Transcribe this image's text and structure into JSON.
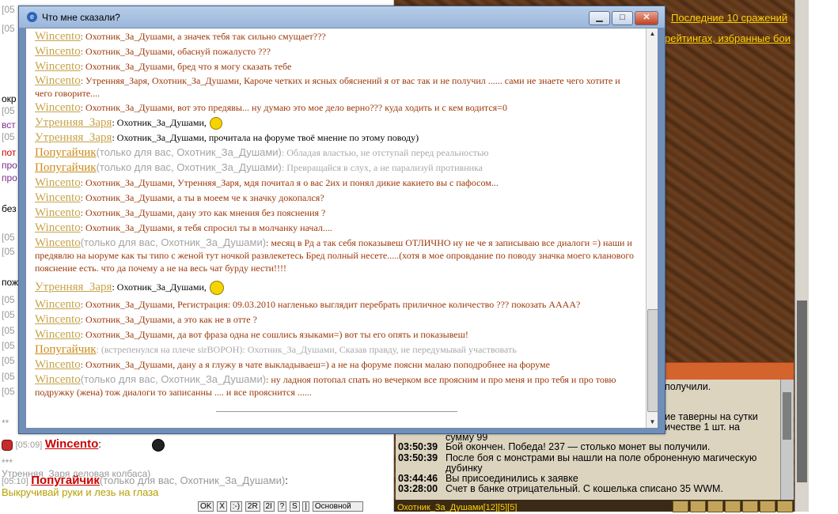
{
  "window": {
    "title": "Что мне сказали?",
    "buttons": {
      "minimize": "▁",
      "maximize": "□",
      "close": "✕"
    },
    "messages": [
      {
        "nick": "Wincento",
        "private": "",
        "text": ": Охотник_За_Душами, а значек тебя так сильно смущает???"
      },
      {
        "nick": "Wincento",
        "private": "",
        "text": ": Охотник_За_Душами, обаснуй пожалусто ???"
      },
      {
        "nick": "Wincento",
        "private": "",
        "text": ": Охотник_За_Душами, бред что я могу сказать тебе"
      },
      {
        "nick": "Wincento",
        "private": "",
        "text": ": Утренняя_Заря, Охотник_За_Душами, Кароче четких и ясных обяснений я от вас так и не получил ...... сами не знаете чего хотите и чего говорите...."
      },
      {
        "nick": "Wincento",
        "private": "",
        "text": ": Охотник_За_Душами, вот это предявы... ну думаю это мое дело верно??? куда ходить и с кем водится=0"
      },
      {
        "nick": "Утренняя_Заря",
        "private": "",
        "text": ": Охотник_За_Душами,"
      },
      {
        "nick": "Утренняя_Заря",
        "private": "",
        "text": ": Охотник_За_Душами, прочитала на форуме твоё мнение по этому поводу)"
      },
      {
        "nick": "Попугайчик",
        "private": "(только для вас, Охотник_За_Душами)",
        "text": ": Обладая властью, не отступай перед реальностью"
      },
      {
        "nick": "Попугайчик",
        "private": "(только для вас, Охотник_За_Душами)",
        "text": ": Превращайся в слух, а не парализуй противника"
      },
      {
        "nick": "Wincento",
        "private": "",
        "text": ": Охотник_За_Душами, Утренняя_Заря, мдя почитал я о вас 2их и понял дикие какието вы с пафосом..."
      },
      {
        "nick": "Wincento",
        "private": "",
        "text": ": Охотник_За_Душами, а ты в моеем че к значку докопался?"
      },
      {
        "nick": "Wincento",
        "private": "",
        "text": ": Охотник_За_Душами, дану это как мнения без пояснения ?"
      },
      {
        "nick": "Wincento",
        "private": "",
        "text": ": Охотник_За_Душами, я тебя спросил ты в молчанку начал...."
      },
      {
        "nick": "Wincento",
        "private": "(только для вас, Охотник_За_Душами)",
        "text": ": месяц в Рд а так себя показывеш ОТЛИЧНО ну не че я записываю все диалоги =) наши и предявлю на ыоруме как ты типо с женой тут ночкой развлекетесь Бред полный несете.....(хотя в мое опровдание по поводу значка моего кланового пояснение есть. что да почему а не на весь чат бурду нести!!!!"
      },
      {
        "nick": "Утренняя_Заря",
        "private": "",
        "text": ": Охотник_За_Душами,"
      },
      {
        "nick": "Wincento",
        "private": "",
        "text": ": Охотник_За_Душами, Регистрация: 09.03.2010 нагленько выглядит перебрать приличное количество ??? покозать АААА?"
      },
      {
        "nick": "Wincento",
        "private": "",
        "text": ": Охотник_За_Душами, а это как не в отте ?"
      },
      {
        "nick": "Wincento",
        "private": "",
        "text": ": Охотник_За_Душами, да вот фраза одна не сошлись языками=) вот ты его опять и показывеш!"
      },
      {
        "nick": "Попугайчик",
        "private": "",
        "text": ": (встрепенулся на плече sirВОРОН): Охотник_За_Душами, Сказав правду, не передумывай участвовать"
      },
      {
        "nick": "Wincento",
        "private": "",
        "text": ": Охотник_За_Душами, дану а я глужу в чате выкладываеш=) а не на форуме поясни малаю поподробнее на форуме"
      },
      {
        "nick": "Wincento",
        "private": "(только для вас, Охотник_За_Душами)",
        "text": ": ну ладноя потопал спать но вечерком все проясним и про меня и про тебя и про товю подружку (жена) тож диалоги то записанны .... и все прояснится ......"
      }
    ]
  },
  "background_chat": {
    "lines": [
      {
        "ts": "[05:09]",
        "nick": "Wincento",
        "text": ":"
      },
      {
        "ts": "***",
        "text": "Утренняя_Заря деловая колбаса)"
      },
      {
        "ts": "[05:10]",
        "nick": "Попугайчик",
        "private": "(только для вас, Охотник_За_Душами)",
        "text": ":"
      },
      {
        "text": "Выкручивай руки и лезь на глаза"
      }
    ],
    "left_fragments": [
      "[05",
      "[05",
      "окр",
      "[05",
      "вст",
      "[05",
      "пот",
      "про",
      "про",
      "без",
      "[05",
      "[05",
      "пож",
      "[05",
      "[05",
      "[05",
      "[05",
      "[05",
      "[05",
      "[05",
      "**"
    ]
  },
  "chat_toolbar": {
    "buttons": [
      "OK",
      "X",
      ":-)",
      "2R",
      "2I",
      "?",
      "S",
      "|"
    ],
    "channel": "Основной"
  },
  "right_panel": {
    "links": [
      "Последние 10 сражений",
      "рейтингах, избранные бои"
    ],
    "log": [
      {
        "time": "",
        "text": "получили."
      },
      {
        "time": "",
        "text": "ие таверны на сутки"
      },
      {
        "time": "",
        "text": "ичестве 1 шт. на"
      },
      {
        "time": "",
        "text": "сумму 99"
      },
      {
        "time": "03:50:39",
        "text": "Бой окончен. Победа! 237 — столько монет вы получили."
      },
      {
        "time": "03:50:39",
        "text": "После боя с монстрами вы нашли на поле оброненную магическую"
      },
      {
        "time": "",
        "text": "дубинку"
      },
      {
        "time": "03:44:46",
        "text": "Вы присоединились к заявке"
      },
      {
        "time": "03:28:00",
        "text": "Счет в банке отрицательный. С кошелька списано 35 WWM."
      }
    ],
    "footer_text": "Охотник_За_Душами[12][5][5]"
  }
}
